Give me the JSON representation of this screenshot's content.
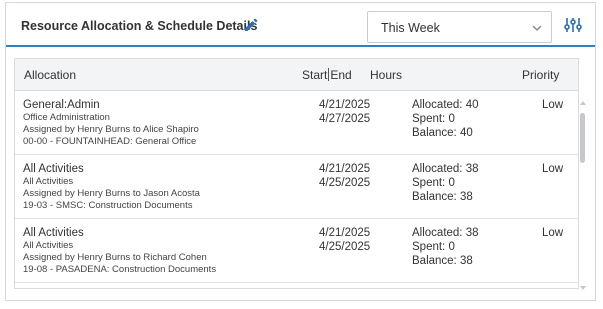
{
  "header": {
    "title": "Resource Allocation & Schedule Details",
    "period": "This Week",
    "accent_color": "#2f7fc1",
    "icons": [
      "edit-icon",
      "chevron-down-icon",
      "filter-sliders-icon"
    ]
  },
  "table": {
    "columns": {
      "allocation": "Allocation",
      "start": "Start",
      "end": "End",
      "hours": "Hours",
      "priority": "Priority"
    },
    "rows": [
      {
        "name": "General:Admin",
        "activity": "Office Administration",
        "assigned": "Assigned by Henry Burns to Alice Shapiro",
        "project": "00-00 - FOUNTAINHEAD: General Office",
        "start": "4/21/2025",
        "end": "4/27/2025",
        "allocated": "Allocated: 40",
        "spent": "Spent: 0",
        "balance": "Balance: 40",
        "priority": "Low"
      },
      {
        "name": "All Activities",
        "activity": "All Activities",
        "assigned": "Assigned by Henry Burns to Jason Acosta",
        "project": "19-03 - SMSC: Construction Documents",
        "start": "4/21/2025",
        "end": "4/25/2025",
        "allocated": "Allocated: 38",
        "spent": "Spent: 0",
        "balance": "Balance: 38",
        "priority": "Low"
      },
      {
        "name": "All Activities",
        "activity": "All Activities",
        "assigned": "Assigned by Henry Burns to Richard Cohen",
        "project": "19-08 - PASADENA: Construction Documents",
        "start": "4/21/2025",
        "end": "4/25/2025",
        "allocated": "Allocated: 38",
        "spent": "Spent: 0",
        "balance": "Balance: 38",
        "priority": "Low"
      }
    ]
  }
}
